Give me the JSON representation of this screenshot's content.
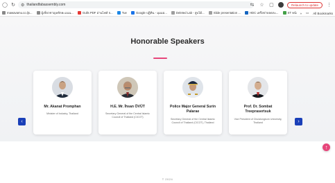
{
  "browser": {
    "url": "thailandfabassembly.com",
    "relaunch_label": "Relaunch to update",
    "bookmarks": [
      {
        "label": "mawavamu.co.ljs...",
        "color": "#888888"
      },
      {
        "label": "ผู้เชี่ยวชาญหลักคะแนน...",
        "color": "#8a8a8a"
      },
      {
        "label": "Gulls PDF อ่านไฟล์ จ...",
        "color": "#e53935"
      },
      {
        "label": "Tue",
        "color": "#1e88e5"
      },
      {
        "label": "Google ปฏิทิน - มุมมอ...",
        "color": "#1a73e8"
      },
      {
        "label": "Deleted Lab - สูบได้...",
        "color": "#9e9e9e"
      },
      {
        "label": "Slide presentation ...",
        "color": "#9e9e9e"
      },
      {
        "label": "HDC เครือข่ายลดละ...",
        "color": "#1565c0"
      },
      {
        "label": "ST หนังสือคำขอจากสุข...",
        "color": "#43a047"
      }
    ],
    "bookmarks_more": "»",
    "all_bookmarks_label": "All Bookmarks"
  },
  "page": {
    "title": "Honorable Speakers",
    "footer": "T 2024"
  },
  "speakers": [
    {
      "name": "Mr. Akanat Promphan",
      "role": "Minister of Industry, Thailand"
    },
    {
      "name": "H.E. Mr. İhsan ÖVÜT",
      "role": "Secretary General of the Central Islamic Council of Thailand (CICOT)"
    },
    {
      "name": "Police Major General Surin Palarae",
      "role": "Secretary General of the Central Islamic Council of Thailand (CICOT), Thailand"
    },
    {
      "name": "Prof. Dr. Sombat Treeprasertsuk",
      "role": "Vice President of Chulalongkorn University, Thailand"
    }
  ],
  "carousel": {
    "prev": "‹",
    "next": "›",
    "page_count": 2,
    "active_page": 1
  },
  "fab_label": "↑",
  "colors": {
    "accent": "#e6457a",
    "nav_button": "#1a3fb8"
  }
}
